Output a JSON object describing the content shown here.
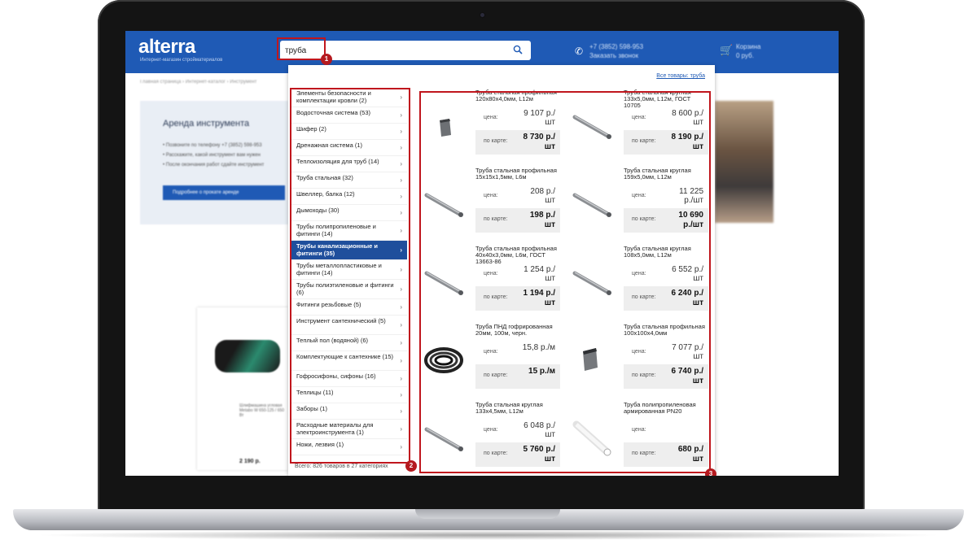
{
  "site": {
    "logo": "alterra",
    "logo_sub": "Интернет-магазин стройматериалов",
    "phone": "+7 (3852) 598-953\nЗаказать звонок",
    "cart": "Корзина\n0 руб."
  },
  "search": {
    "value": "труба",
    "placeholder": ""
  },
  "background": {
    "breadcrumb": "Главная страница › Интернет-каталог › Инструмент",
    "rent_title": "Аренда инструмента",
    "rent_lines": [
      "• Позвоните по телефону +7 (3852) 598-953",
      "• Расскажите, какой инструмент вам нужен",
      "• После окончания работ сдайте инструмент"
    ],
    "rent_button": "Подробнее о прокате аренде",
    "card_title": "Шлифмашина угловая Metabo W 650-125 / 650 Вт",
    "card_price": "2 190 р."
  },
  "dropdown": {
    "all_goods_link": "Все товары: труба",
    "total": "Всего: 826 товаров в 27 категориях",
    "categories": [
      {
        "label": "Элементы безопасности и комплектации кровли (2)",
        "active": false,
        "tall": true
      },
      {
        "label": "Водосточная система (53)",
        "active": false,
        "tall": false
      },
      {
        "label": "Шифер (2)",
        "active": false,
        "tall": false
      },
      {
        "label": "Дренажная система (1)",
        "active": false,
        "tall": false
      },
      {
        "label": "Теплоизоляция для труб (14)",
        "active": false,
        "tall": false
      },
      {
        "label": "Труба стальная (32)",
        "active": false,
        "tall": false
      },
      {
        "label": "Швеллер, балка (12)",
        "active": false,
        "tall": false
      },
      {
        "label": "Дымоходы (30)",
        "active": false,
        "tall": false
      },
      {
        "label": "Трубы полипропиленовые и фитинги (14)",
        "active": false,
        "tall": true
      },
      {
        "label": "Трубы канализационные и фитинги (35)",
        "active": true,
        "tall": true
      },
      {
        "label": "Трубы металлопластиковые и фитинги (14)",
        "active": false,
        "tall": true
      },
      {
        "label": "Трубы полиэтиленовые и фитинги (6)",
        "active": false,
        "tall": true
      },
      {
        "label": "Фитинги резьбовые (5)",
        "active": false,
        "tall": false
      },
      {
        "label": "Инструмент сантехнический (5)",
        "active": false,
        "tall": true
      },
      {
        "label": "Теплый пол (водяной) (6)",
        "active": false,
        "tall": false
      },
      {
        "label": "Комплектующие к сантехнике (15)",
        "active": false,
        "tall": true
      },
      {
        "label": "Гофросифоны, сифоны (16)",
        "active": false,
        "tall": false
      },
      {
        "label": "Теплицы (11)",
        "active": false,
        "tall": false
      },
      {
        "label": "Заборы (1)",
        "active": false,
        "tall": false
      },
      {
        "label": "Расходные материалы для электроинструмента (1)",
        "active": false,
        "tall": true
      },
      {
        "label": "Ножи, лезвия (1)",
        "active": false,
        "tall": false
      }
    ],
    "price_label": "цена:",
    "card_label": "по карте:",
    "products": [
      {
        "title": "Труба стальная профильная 120х80х4,0мм, L12м",
        "price": "9 107 р./\nшт",
        "card_price": "8 730 р./\nшт",
        "img": "profile"
      },
      {
        "title": "Труба стальная круглая 133х5,0мм, L12м, ГОСТ 10705",
        "price": "8 600 р./\nшт",
        "card_price": "8 190 р./\nшт",
        "img": "round"
      },
      {
        "title": "Труба стальная профильная 15х15х1,5мм, L6м",
        "price": "208 р./\nшт",
        "card_price": "198 р./\nшт",
        "img": "round"
      },
      {
        "title": "Труба стальная круглая 159х5,0мм, L12м",
        "price": "11 225\nр./шт",
        "card_price": "10 690\nр./шт",
        "img": "round"
      },
      {
        "title": "Труба стальная профильная 40х40х3,0мм, L6м, ГОСТ 13663-86",
        "price": "1 254 р./\nшт",
        "card_price": "1 194 р./\nшт",
        "img": "round"
      },
      {
        "title": "Труба стальная круглая 108х5,0мм, L12м",
        "price": "6 552 р./\nшт",
        "card_price": "6 240 р./\nшт",
        "img": "round"
      },
      {
        "title": "Труба ПНД гофрированная 20мм, 100м, черн.",
        "price": "15,8 р./м",
        "card_price": "15 р./м",
        "img": "coil"
      },
      {
        "title": "Труба стальная профильная 100х100х4,0мм",
        "price": "7 077 р./\nшт",
        "card_price": "6 740 р./\nшт",
        "img": "square"
      },
      {
        "title": "Труба стальная круглая 133х4,5мм, L12м",
        "price": "6 048 р./\nшт",
        "card_price": "5 760 р./\nшт",
        "img": "round"
      },
      {
        "title": "Труба полипропиленовая армированная PN20",
        "price": "",
        "card_price": "680 р./\nшт",
        "img": "pp"
      }
    ]
  },
  "annotations": {
    "b1": "1",
    "b2": "2",
    "b3": "3"
  },
  "colors": {
    "brand_blue": "#1f5ab5",
    "active_category": "#1f4f9c",
    "annotation_red": "#c0161d"
  }
}
